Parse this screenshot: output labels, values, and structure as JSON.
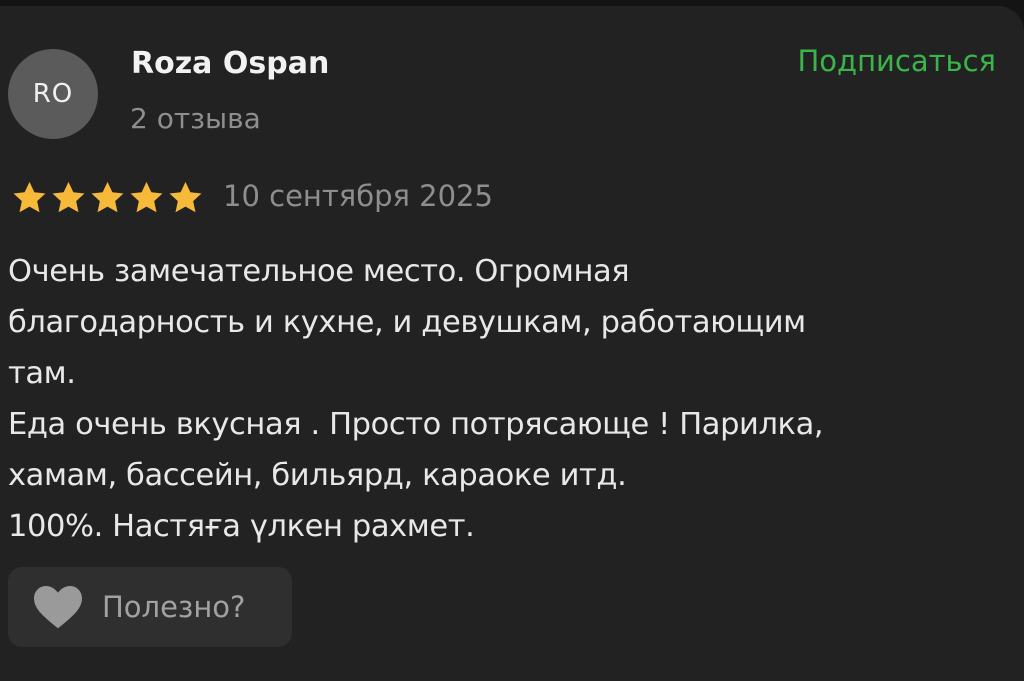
{
  "author": {
    "initials": "RO",
    "name": "Roza Ospan",
    "reviews_count": "2 отзыва"
  },
  "subscribe_label": "Подписаться",
  "rating": {
    "stars": 5,
    "max": 5,
    "date": "10 сентября 2025"
  },
  "review": {
    "lines": [
      "Очень замечательное место. Огромная",
      "благодарность и кухне, и девушкам, работающим",
      "там.",
      "Еда очень вкусная . Просто потрясающе ! Парилка,",
      "хамам, бассейн, бильярд, караоке итд.",
      "100%. Настяға үлкен рахмет."
    ]
  },
  "helpful": {
    "label": "Полезно?",
    "icon": "heart-icon"
  },
  "colors": {
    "background": "#222222",
    "accent_green": "#3bb54a",
    "star": "#f6b93a",
    "muted_text": "#8e8e8e",
    "avatar_bg": "#5b5b5b",
    "button_bg": "#2f2f2f"
  }
}
